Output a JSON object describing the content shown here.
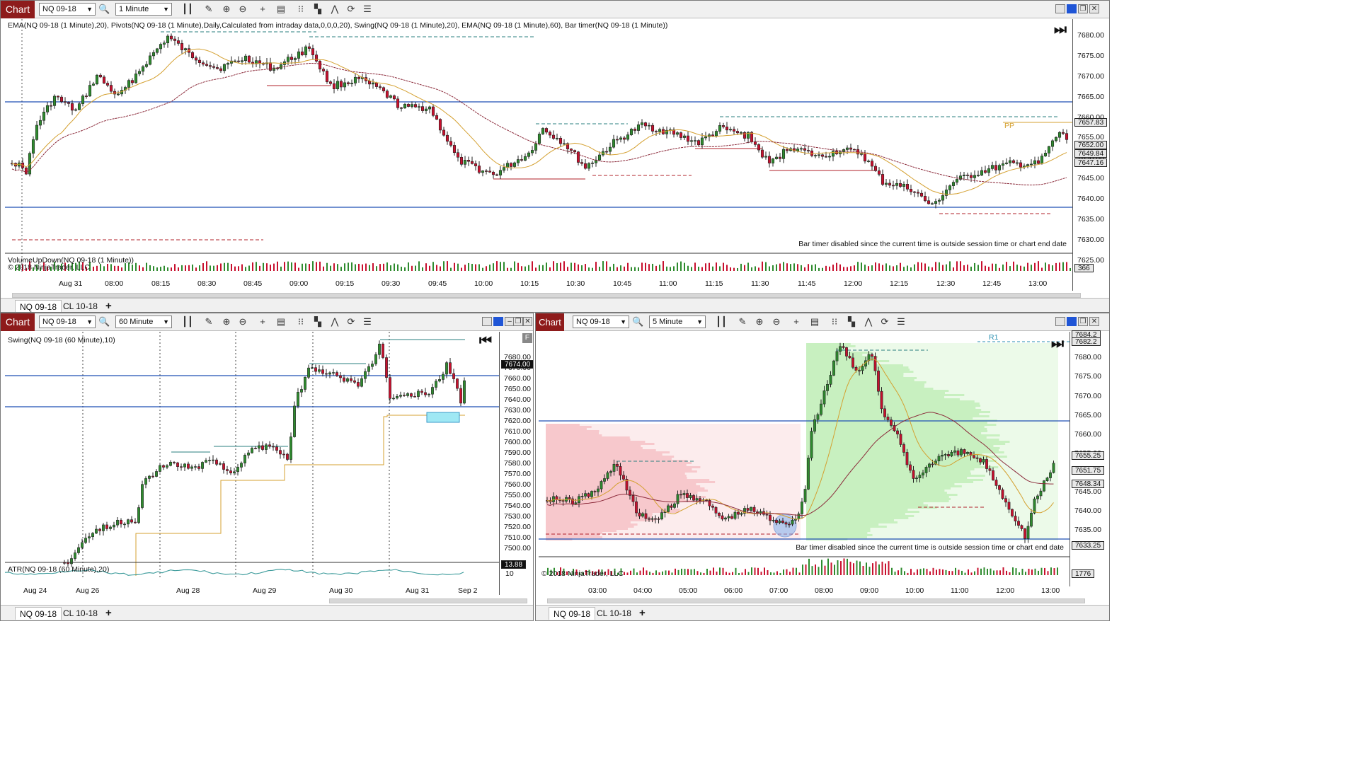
{
  "colors": {
    "up": "#2e8b2e",
    "down": "#c8102e",
    "ema_fast": "#d4a030",
    "ema_slow": "#8b2a3a",
    "pivot": "#1e4fb3",
    "swing_high": "#2a7f7f",
    "swing_low": "#b0202a",
    "brand": "#8e1b1b",
    "profile_sell": "#f7c8cc",
    "profile_buy": "#c8f0c0",
    "atr": "#3a9a9a"
  },
  "top_chart": {
    "brand": "Chart",
    "instrument": "NQ 09-18",
    "interval": "1 Minute",
    "indicators_label": "EMA(NQ 09-18 (1 Minute),20), Pivots(NQ 09-18 (1 Minute),Daily,Calculated from intraday data,0,0,0,20), Swing(NQ 09-18 (1 Minute),20), EMA(NQ 09-18 (1 Minute),60), Bar timer(NQ 09-18 (1 Minute))",
    "volume_label": "VolumeUpDown(NQ 09-18 (1 Minute))",
    "copyright": "© 2018 NinjaTrader, LLC",
    "bar_timer_message": "Bar timer disabled since the current time is outside session time or chart end date",
    "pivot_label": "PP",
    "price_ticks": [
      "7680.00",
      "7675.00",
      "7670.00",
      "7665.00",
      "7660.00",
      "7655.00",
      "7650.00",
      "7645.00",
      "7640.00",
      "7635.00",
      "7630.00",
      "7625.00"
    ],
    "price_badges": [
      "7657.83",
      "7652.00",
      "7649.84",
      "7647.16"
    ],
    "volume_badge": "366",
    "time_ticks": [
      "Aug 31",
      "08:00",
      "08:15",
      "08:30",
      "08:45",
      "09:00",
      "09:15",
      "09:30",
      "09:45",
      "10:00",
      "10:15",
      "10:30",
      "10:45",
      "11:00",
      "11:15",
      "11:30",
      "11:45",
      "12:00",
      "12:15",
      "12:30",
      "12:45",
      "13:00"
    ],
    "tabs": [
      "NQ 09-18",
      "CL 10-18",
      "+"
    ],
    "price_range": [
      7622,
      7684
    ]
  },
  "left_chart": {
    "brand": "Chart",
    "instrument": "NQ 09-18",
    "interval": "60 Minute",
    "indicators_label": "Swing(NQ 09-18 (60 Minute),10)",
    "atr_label": "ATR(NQ 09-18 (60 Minute),20)",
    "atr_badge": "13.88",
    "atr_tick": "10",
    "current_price": "7674.00",
    "price_ticks": [
      "7680.00",
      "7670.00",
      "7660.00",
      "7650.00",
      "7640.00",
      "7630.00",
      "7620.00",
      "7610.00",
      "7600.00",
      "7590.00",
      "7580.00",
      "7570.00",
      "7560.00",
      "7550.00",
      "7540.00",
      "7530.00",
      "7520.00",
      "7510.00",
      "7500.00"
    ],
    "time_ticks": [
      "Aug 24",
      "Aug 26",
      "Aug 28",
      "Aug 29",
      "Aug 30",
      "Aug 31",
      "Sep 2"
    ],
    "tabs": [
      "NQ 09-18",
      "CL 10-18",
      "+"
    ],
    "price_range": [
      7495,
      7692
    ]
  },
  "right_chart": {
    "brand": "Chart",
    "instrument": "NQ 09-18",
    "interval": "5 Minute",
    "copyright": "© 2018 NinjaTrader, LLC",
    "bar_timer_message": "Bar timer disabled since the current time is outside session time or chart end date",
    "pivot_label": "R1",
    "price_ticks": [
      "7680.00",
      "7675.00",
      "7670.00",
      "7665.00",
      "7660.00",
      "7655.00",
      "7650.00",
      "7645.00",
      "7640.00",
      "7635.00"
    ],
    "price_badges": [
      "7684.2",
      "7682.2",
      "7655.25",
      "7651.75",
      "7648.34",
      "7633.25"
    ],
    "volume_badge": "1776",
    "time_ticks": [
      "03:00",
      "04:00",
      "05:00",
      "06:00",
      "07:00",
      "08:00",
      "09:00",
      "10:00",
      "11:00",
      "12:00",
      "13:00"
    ],
    "tabs": [
      "NQ 09-18",
      "CL 10-18",
      "+"
    ],
    "price_range": [
      7632,
      7686
    ]
  }
}
